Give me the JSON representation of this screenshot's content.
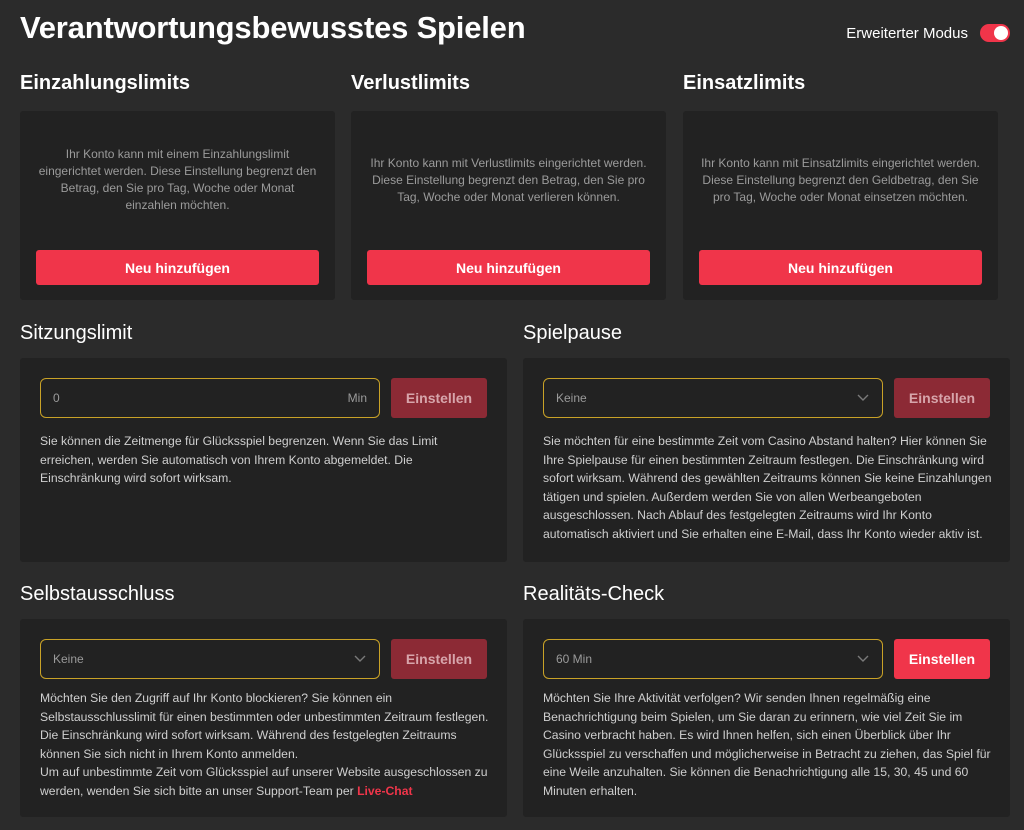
{
  "header": {
    "title": "Verantwortungsbewusstes Spielen",
    "mode_label": "Erweiterter Modus"
  },
  "limits": [
    {
      "title": "Einzahlungslimits",
      "description": "Ihr Konto kann mit einem Einzahlungslimit eingerichtet werden. Diese Einstellung begrenzt den Betrag, den Sie pro Tag, Woche oder Monat einzahlen möchten.",
      "button": "Neu hinzufügen"
    },
    {
      "title": "Verlustlimits",
      "description": "Ihr Konto kann mit Verlustlimits eingerichtet werden. Diese Einstellung begrenzt den Betrag, den Sie pro Tag, Woche oder Monat verlieren können.",
      "button": "Neu hinzufügen"
    },
    {
      "title": "Einsatzlimits",
      "description": "Ihr Konto kann mit Einsatzlimits eingerichtet werden. Diese Einstellung begrenzt den Geldbetrag, den Sie pro Tag, Woche oder Monat einsetzen möchten.",
      "button": "Neu hinzufügen"
    }
  ],
  "session": {
    "title": "Sitzungslimit",
    "value": "0",
    "unit": "Min",
    "button": "Einstellen",
    "text": "Sie können die Zeitmenge für Glücksspiel begrenzen. Wenn Sie das Limit erreichen, werden Sie automatisch von Ihrem Konto abgemeldet. Die Einschränkung wird sofort wirksam."
  },
  "pause": {
    "title": "Spielpause",
    "selected": "Keine",
    "button": "Einstellen",
    "text": "Sie möchten für eine bestimmte Zeit vom Casino Abstand halten? Hier können Sie Ihre Spielpause für einen bestimmten Zeitraum festlegen. Die Einschränkung wird sofort wirksam. Während des gewählten Zeitraums können Sie keine Einzahlungen tätigen und spielen. Außerdem werden Sie von allen Werbeangeboten ausgeschlossen. Nach Ablauf des festgelegten Zeitraums wird Ihr Konto automatisch aktiviert und Sie erhalten eine E-Mail, dass Ihr Konto wieder aktiv ist."
  },
  "exclusion": {
    "title": "Selbstausschluss",
    "selected": "Keine",
    "button": "Einstellen",
    "text": "Möchten Sie den Zugriff auf Ihr Konto blockieren? Sie können ein Selbstausschlusslimit für einen bestimmten oder unbestimmten Zeitraum festlegen. Die Einschränkung wird sofort wirksam. Während des festgelegten Zeitraums können Sie sich nicht in Ihrem Konto anmelden.",
    "text2": "Um auf unbestimmte Zeit vom Glücksspiel auf unserer Website ausgeschlossen zu werden, wenden Sie sich bitte an unser Support-Team per",
    "link": "Live-Chat"
  },
  "reality": {
    "title": "Realitäts-Check",
    "selected": "60 Min",
    "button": "Einstellen",
    "text": "Möchten Sie Ihre Aktivität verfolgen? Wir senden Ihnen regelmäßig eine Benachrichtigung beim Spielen, um Sie daran zu erinnern, wie viel Zeit Sie im Casino verbracht haben. Es wird Ihnen helfen, sich einen Überblick über Ihr Glücksspiel zu verschaffen und möglicherweise in Betracht zu ziehen, das Spiel für eine Weile anzuhalten. Sie können die Benachrichtigung alle 15, 30, 45 und 60 Minuten erhalten."
  },
  "colors": {
    "accent": "#f0354a",
    "field_border": "#c9a227",
    "panel": "#222222",
    "background": "#2b2b2b"
  }
}
